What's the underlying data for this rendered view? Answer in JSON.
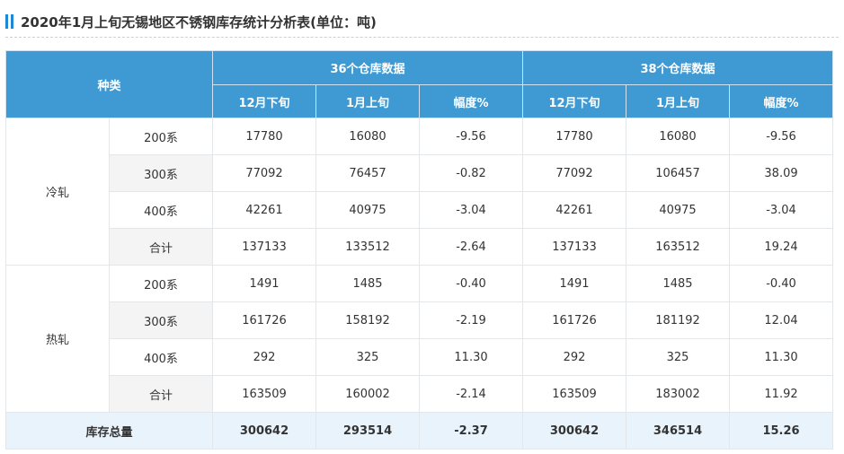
{
  "title": "2020年1月上旬无锡地区不锈钢库存统计分析表(单位：吨)",
  "header": {
    "kind": "种类",
    "group_36": "36个仓库数据",
    "group_38": "38个仓库数据",
    "col_prev": "12月下旬",
    "col_curr": "1月上旬",
    "col_pct": "幅度%"
  },
  "groups": [
    {
      "name": "冷轧",
      "rows": [
        {
          "label": "200系",
          "v": [
            "17780",
            "16080",
            "-9.56",
            "17780",
            "16080",
            "-9.56"
          ]
        },
        {
          "label": "300系",
          "v": [
            "77092",
            "76457",
            "-0.82",
            "77092",
            "106457",
            "38.09"
          ]
        },
        {
          "label": "400系",
          "v": [
            "42261",
            "40975",
            "-3.04",
            "42261",
            "40975",
            "-3.04"
          ]
        },
        {
          "label": "合计",
          "v": [
            "137133",
            "133512",
            "-2.64",
            "137133",
            "163512",
            "19.24"
          ]
        }
      ]
    },
    {
      "name": "热轧",
      "rows": [
        {
          "label": "200系",
          "v": [
            "1491",
            "1485",
            "-0.40",
            "1491",
            "1485",
            "-0.40"
          ]
        },
        {
          "label": "300系",
          "v": [
            "161726",
            "158192",
            "-2.19",
            "161726",
            "181192",
            "12.04"
          ]
        },
        {
          "label": "400系",
          "v": [
            "292",
            "325",
            "11.30",
            "292",
            "325",
            "11.30"
          ]
        },
        {
          "label": "合计",
          "v": [
            "163509",
            "160002",
            "-2.14",
            "163509",
            "183002",
            "11.92"
          ]
        }
      ]
    }
  ],
  "total": {
    "label": "库存总量",
    "v": [
      "300642",
      "293514",
      "-2.37",
      "300642",
      "346514",
      "15.26"
    ]
  }
}
